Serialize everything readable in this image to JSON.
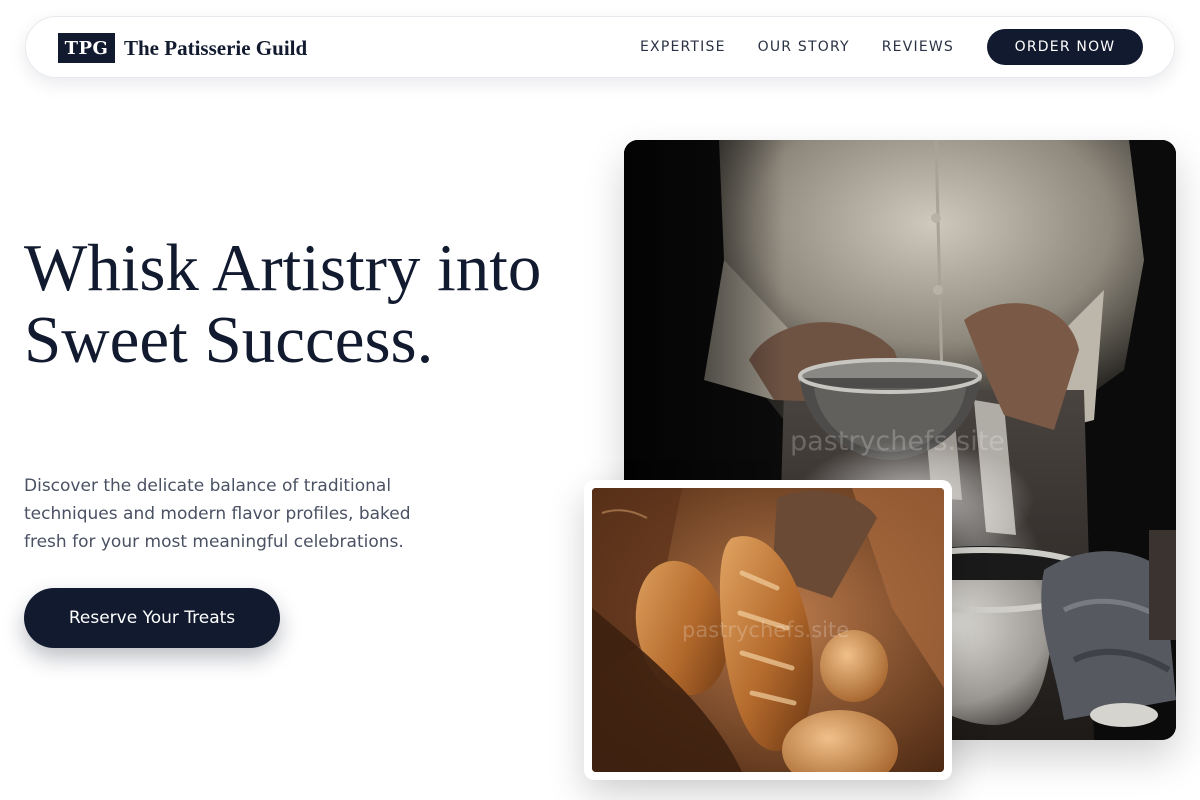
{
  "nav": {
    "logo_mark": "TPG",
    "brand_name": "The Patisserie Guild",
    "links": [
      "EXPERTISE",
      "OUR STORY",
      "REVIEWS"
    ],
    "cta_label": "ORDER NOW"
  },
  "hero": {
    "title": "Whisk Artistry into Sweet Success.",
    "description": "Discover the delicate balance of traditional techniques and modern flavor profiles, baked fresh for your most meaningful celebrations.",
    "button_label": "Reserve Your Treats"
  },
  "images": {
    "main_watermark": "pastrychefs.site",
    "secondary_watermark": "pastrychefs.site"
  },
  "colors": {
    "primary": "#111a2e",
    "background": "#ffffff",
    "body_text": "#4a5163"
  }
}
